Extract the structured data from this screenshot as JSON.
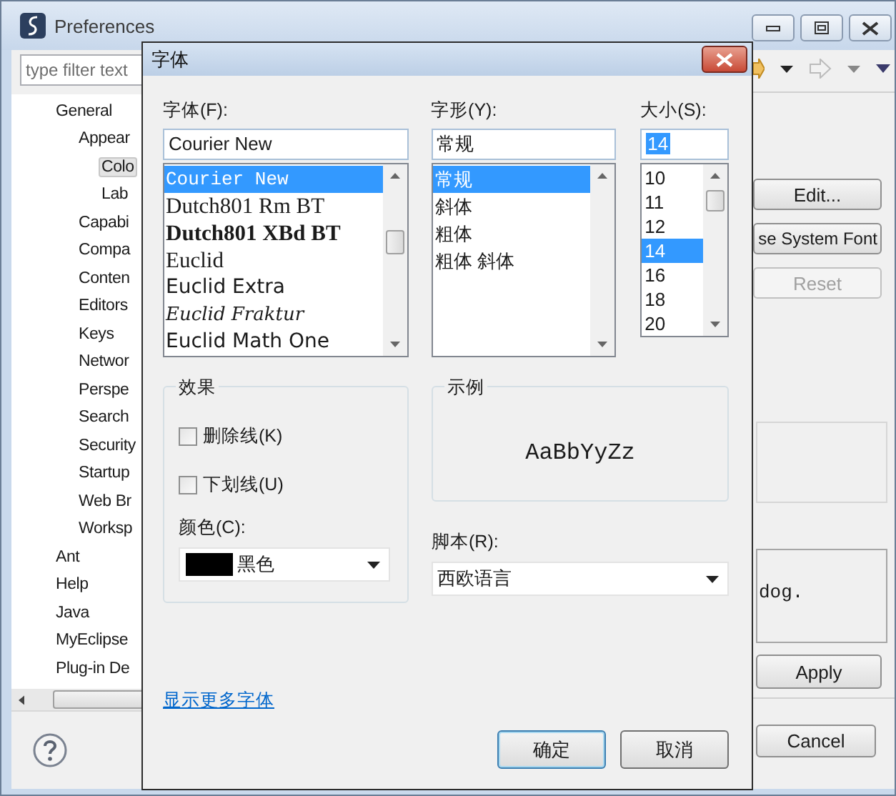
{
  "window": {
    "title": "Preferences",
    "filter": {
      "placeholder": "type filter text"
    },
    "tree": [
      {
        "label": "General",
        "selected": false,
        "children": [
          {
            "label": "Appear",
            "selected": false,
            "children": [
              {
                "label": "Colo",
                "selected": true
              },
              {
                "label": "Lab",
                "selected": false
              }
            ]
          },
          {
            "label": "Capabi",
            "selected": false
          },
          {
            "label": "Compa",
            "selected": false
          },
          {
            "label": "Conten",
            "selected": false
          },
          {
            "label": "Editors",
            "selected": false
          },
          {
            "label": "Keys",
            "selected": false
          },
          {
            "label": "Networ",
            "selected": false
          },
          {
            "label": "Perspe",
            "selected": false
          },
          {
            "label": "Search",
            "selected": false
          },
          {
            "label": "Security",
            "selected": false
          },
          {
            "label": "Startup",
            "selected": false
          },
          {
            "label": "Web Br",
            "selected": false
          },
          {
            "label": "Worksp",
            "selected": false
          }
        ]
      },
      {
        "label": "Ant",
        "selected": false
      },
      {
        "label": "Help",
        "selected": false
      },
      {
        "label": "Java",
        "selected": false
      },
      {
        "label": "MyEclipse",
        "selected": false
      },
      {
        "label": "Plug-in De",
        "selected": false
      }
    ],
    "side_buttons": [
      {
        "label": "Edit...",
        "disabled": false
      },
      {
        "label": "se System Font",
        "disabled": false
      },
      {
        "label": "Reset",
        "disabled": true
      }
    ],
    "preview_text": "dog.",
    "apply_button": "Apply",
    "cancel_button": "Cancel"
  },
  "dialog": {
    "title": "字体",
    "font": {
      "label": "字体(F):",
      "value": "Courier New",
      "items": [
        {
          "name": "Courier New",
          "kind": "mono",
          "selected": true
        },
        {
          "name": "Dutch801 Rm BT",
          "kind": "serif",
          "selected": false
        },
        {
          "name": "Dutch801 XBd BT",
          "kind": "serif-bold",
          "selected": false
        },
        {
          "name": "Euclid",
          "kind": "serif",
          "selected": false
        },
        {
          "name": "Euclid Extra",
          "kind": "sans",
          "selected": false
        },
        {
          "name": "Euclid Fraktur",
          "kind": "blackletter",
          "selected": false
        },
        {
          "name": "Euclid Math One",
          "kind": "sans",
          "selected": false
        }
      ]
    },
    "style": {
      "label": "字形(Y):",
      "value": "常规",
      "items": [
        {
          "name": "常规",
          "selected": true
        },
        {
          "name": "斜体",
          "selected": false
        },
        {
          "name": "粗体",
          "selected": false
        },
        {
          "name": "粗体 斜体",
          "selected": false
        }
      ]
    },
    "size": {
      "label": "大小(S):",
      "value": "14",
      "items": [
        {
          "name": "10",
          "selected": false
        },
        {
          "name": "11",
          "selected": false
        },
        {
          "name": "12",
          "selected": false
        },
        {
          "name": "14",
          "selected": true
        },
        {
          "name": "16",
          "selected": false
        },
        {
          "name": "18",
          "selected": false
        },
        {
          "name": "20",
          "selected": false
        }
      ]
    },
    "effects": {
      "title": "效果",
      "options": [
        {
          "label": "删除线(K)",
          "checked": false
        },
        {
          "label": "下划线(U)",
          "checked": false
        }
      ],
      "color_label": "颜色(C):",
      "color": {
        "name": "黑色",
        "color": "#000000"
      }
    },
    "sample": {
      "title": "示例",
      "text": "AaBbYyZz"
    },
    "script": {
      "label": "脚本(R):",
      "value": "西欧语言"
    },
    "more_fonts_link": "显示更多字体",
    "buttons": [
      {
        "label": "确定",
        "default": true
      },
      {
        "label": "取消",
        "default": false
      }
    ]
  }
}
